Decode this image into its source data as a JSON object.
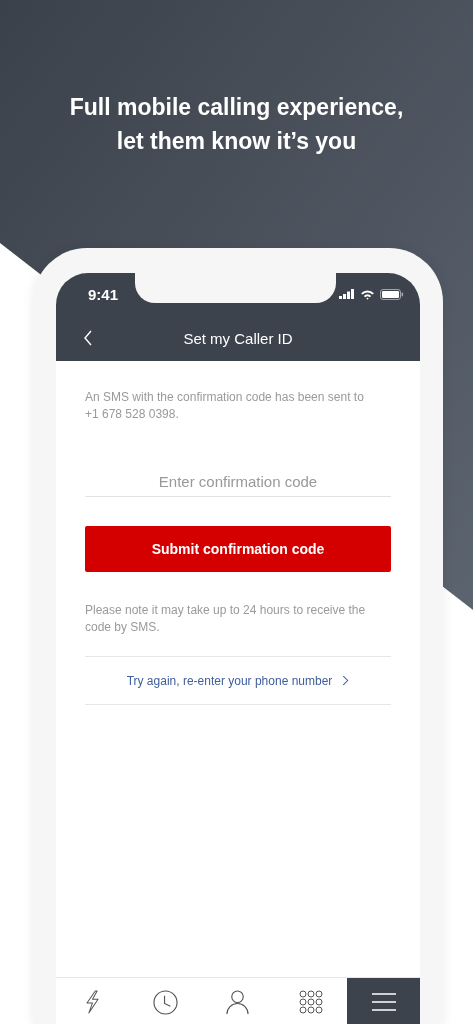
{
  "headline": "Full mobile calling experience,\nlet them know it’s you",
  "status_bar": {
    "time": "9:41"
  },
  "nav": {
    "title": "Set my Caller ID"
  },
  "message": "An SMS with the confirmation code has been sent to +1 678 528 0398.",
  "code_field": {
    "placeholder": "Enter confirmation code"
  },
  "submit_button": "Submit confirmation code",
  "note": "Please note it may take up to 24 hours to receive the code by SMS.",
  "retry_link": "Try again, re-enter your phone number",
  "tabs": [
    {
      "kind": "bolt",
      "selected": false
    },
    {
      "kind": "clock",
      "selected": false
    },
    {
      "kind": "person",
      "selected": false
    },
    {
      "kind": "keypad",
      "selected": false
    },
    {
      "kind": "menu",
      "selected": true
    }
  ]
}
